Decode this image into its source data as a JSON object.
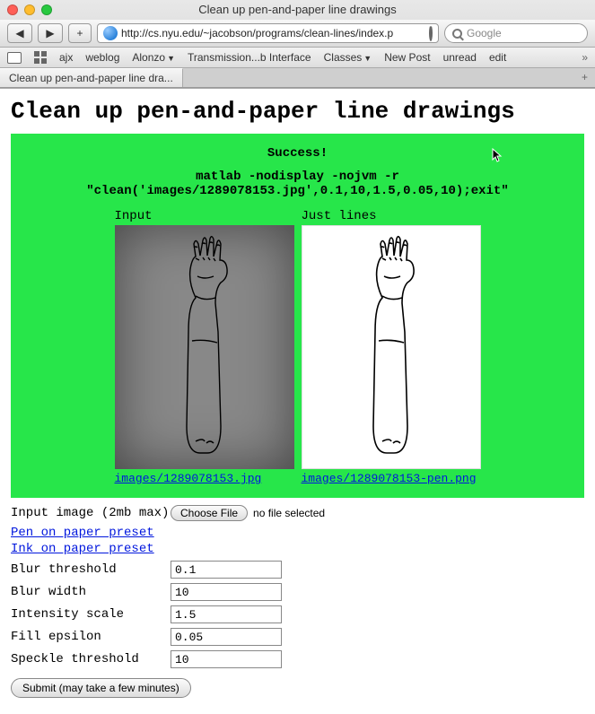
{
  "window": {
    "title": "Clean up pen-and-paper line drawings",
    "url_display": "http://cs.nyu.edu/~jacobson/programs/clean-lines/index.p",
    "search_placeholder": "Google",
    "tab_label": "Clean up pen-and-paper line dra..."
  },
  "bookmarks": [
    "ajx",
    "weblog",
    "Alonzo",
    "Transmission...b Interface",
    "Classes",
    "New Post",
    "unread",
    "edit"
  ],
  "page": {
    "title": "Clean up pen-and-paper line drawings",
    "success": "Success!",
    "command_line1": "matlab -nodisplay -nojvm -r",
    "command_line2": "\"clean('images/1289078153.jpg',0.1,10,1.5,0.05,10);exit\"",
    "panels": {
      "left_label": "Input",
      "left_link": "images/1289078153.jpg",
      "right_label": "Just lines",
      "right_link": "images/1289078153-pen.png"
    },
    "form": {
      "input_image_label": "Input image (2mb max)",
      "choose_file": "Choose File",
      "no_file": "no file selected",
      "preset1": "Pen on paper preset",
      "preset2": "Ink on paper preset",
      "blur_threshold_label": "Blur threshold",
      "blur_threshold_value": "0.1",
      "blur_width_label": "Blur width",
      "blur_width_value": "10",
      "intensity_scale_label": "Intensity scale",
      "intensity_scale_value": "1.5",
      "fill_epsilon_label": "Fill epsilon",
      "fill_epsilon_value": "0.05",
      "speckle_threshold_label": "Speckle threshold",
      "speckle_threshold_value": "10",
      "submit": "Submit (may take a few minutes)"
    }
  }
}
